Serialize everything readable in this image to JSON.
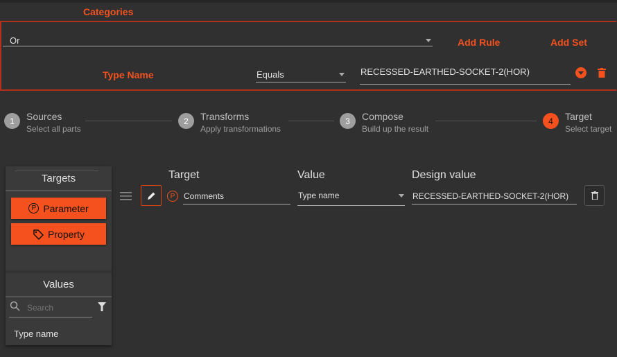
{
  "categories_label": "Categories",
  "ruleset": {
    "combinator": "Or",
    "add_rule": "Add Rule",
    "add_set": "Add Set",
    "rule": {
      "field": "Type Name",
      "operator": "Equals",
      "value": "RECESSED-EARTHED-SOCKET-2(HOR)"
    }
  },
  "stepper": [
    {
      "num": "1",
      "title": "Sources",
      "subtitle": "Select all parts"
    },
    {
      "num": "2",
      "title": "Transforms",
      "subtitle": "Apply transformations"
    },
    {
      "num": "3",
      "title": "Compose",
      "subtitle": "Build up the result"
    },
    {
      "num": "4",
      "title": "Target",
      "subtitle": "Select target"
    }
  ],
  "targets": {
    "title": "Targets",
    "parameter": "Parameter",
    "property": "Property"
  },
  "values": {
    "title": "Values",
    "search_placeholder": "Search",
    "items": [
      "Type name"
    ]
  },
  "mapping": {
    "headers": {
      "target": "Target",
      "value": "Value",
      "design": "Design value"
    },
    "row": {
      "target": "Comments",
      "value": "Type name",
      "design": "RECESSED-EARTHED-SOCKET-2(HOR)"
    }
  },
  "colors": {
    "accent": "#f4511e",
    "border": "#b3301a"
  }
}
